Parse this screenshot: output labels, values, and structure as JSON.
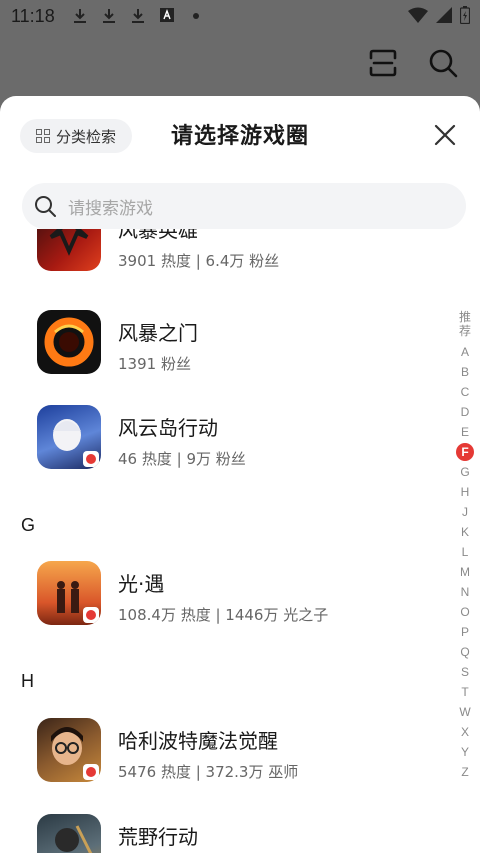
{
  "status_bar": {
    "time": "11:18",
    "notification_icons": [
      "download-icon",
      "download-icon",
      "download-icon",
      "app-a-icon",
      "dot-icon"
    ],
    "right_icons": [
      "wifi-icon",
      "signal-icon",
      "battery-icon"
    ]
  },
  "background_header": {
    "icons": [
      "scan-icon",
      "search-icon"
    ]
  },
  "sheet": {
    "category_button_label": "分类检索",
    "title": "请选择游戏圈",
    "search_placeholder": "请搜索游戏"
  },
  "list": {
    "items": [
      {
        "name": "风暴英雄",
        "stats": "3901 热度 | 6.4万 粉丝"
      },
      {
        "name": "风暴之门",
        "stats": "1391 粉丝"
      },
      {
        "name": "风云岛行动",
        "stats": "46 热度 | 9万 粉丝"
      },
      {
        "section": "G"
      },
      {
        "name": "光·遇",
        "stats": "108.4万 热度 | 1446万 光之子"
      },
      {
        "section": "H"
      },
      {
        "name": "哈利波特魔法觉醒",
        "stats": "5476 热度 | 372.3万 巫师"
      },
      {
        "name": "荒野行动",
        "stats": ""
      }
    ],
    "sections": {
      "g": "G",
      "h": "H"
    },
    "rows": [
      {
        "name": "风暴英雄",
        "stats": "3901 热度 | 6.4万 粉丝"
      },
      {
        "name": "风暴之门",
        "stats": "1391 粉丝"
      },
      {
        "name": "风云岛行动",
        "stats": "46 热度 | 9万 粉丝"
      },
      {
        "name": "光·遇",
        "stats": "108.4万 热度 | 1446万 光之子"
      },
      {
        "name": "哈利波特魔法觉醒",
        "stats": "5476 热度 | 372.3万 巫师"
      },
      {
        "name": "荒野行动",
        "stats": ""
      }
    ]
  },
  "index_bar": {
    "recommend": "推荐",
    "letters": [
      "A",
      "B",
      "C",
      "D",
      "E",
      "F",
      "G",
      "H",
      "J",
      "K",
      "L",
      "M",
      "N",
      "O",
      "P",
      "Q",
      "S",
      "T",
      "W",
      "X",
      "Y",
      "Z"
    ],
    "active": "F",
    "active_color": "#e53935"
  }
}
